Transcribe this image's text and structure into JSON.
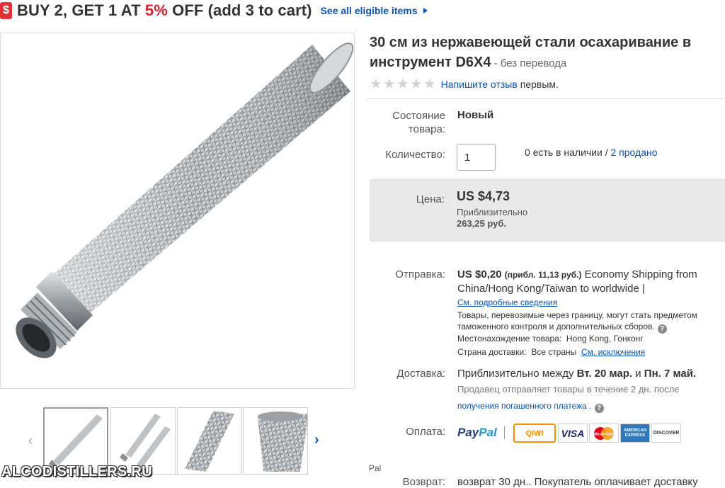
{
  "promo": {
    "badge": "$",
    "text_before": "BUY 2, GET 1 AT ",
    "text_pct": "5%",
    "text_after": " OFF (add 3 to cart)",
    "link": "See all eligible items"
  },
  "watermark": "ALCODISTILLERS.RU",
  "item": {
    "title_line1": "30 см из нержавеющей стали осахаривание в",
    "title_line2": "инструмент D6X4",
    "title_suffix": " - ",
    "no_translation": "без перевода"
  },
  "rating": {
    "stars": "★★★★★",
    "write_review": "Напишите отзыв",
    "first": "первым."
  },
  "condition": {
    "label": "Состояние товара:",
    "value": "Новый"
  },
  "quantity": {
    "label": "Количество:",
    "value": "1",
    "stock": "0 есть в наличии",
    "sep": " / ",
    "sold": "2 продано"
  },
  "price": {
    "label": "Цена:",
    "value": "US $4,73",
    "approx_label": "Приблизительно",
    "approx_value": "263,25 руб."
  },
  "shipping": {
    "label": "Отправка:",
    "cost": "US $0,20",
    "cost_approx": "(прибл. 11,13 руб.)",
    "method": "Economy Shipping from China/Hong Kong/Taiwan to worldwide |",
    "details_link": "См. подробные сведения",
    "customs_note": "Товары, перевозимые через границу, могут стать предметом таможенного контроля и дополнительных сборов.",
    "location_label": "Местонахождение товара:",
    "location_value": "Hong Kong, Гонконг",
    "ships_to_label": "Страна доставки:",
    "ships_to_value": "Все страны",
    "exclusions_link": "См. исключения"
  },
  "delivery": {
    "label": "Доставка:",
    "text": "Приблизительно между ",
    "date1": "Вт. 20 мар.",
    "and": " и ",
    "date2": "Пн. 7 май.",
    "note": "Продавец отправляет товары в течение 2 дн. после",
    "note_link": "получения погашенного платежа",
    "note_end": "."
  },
  "payment": {
    "label": "Оплата:",
    "paypal_1": "Pay",
    "paypal_2": "Pal",
    "qiwi": "QIWI",
    "visa": "VISA",
    "mastercard": "MasterCard",
    "amex": "AMERICAN EXPRESS",
    "discover": "DISCOVER",
    "fragment": "Pal"
  },
  "returns": {
    "label": "Возврат:",
    "text": "возврат 30 дн.. Покупатель оплачивает доставку"
  },
  "colors": {
    "link": "#0654ba",
    "promo_red": "#e43137",
    "price_box": "#e9e9e9"
  },
  "icons": [
    "dollar-tag-icon",
    "chevron-right-icon",
    "chevron-left-icon",
    "star-icon",
    "help-icon"
  ]
}
